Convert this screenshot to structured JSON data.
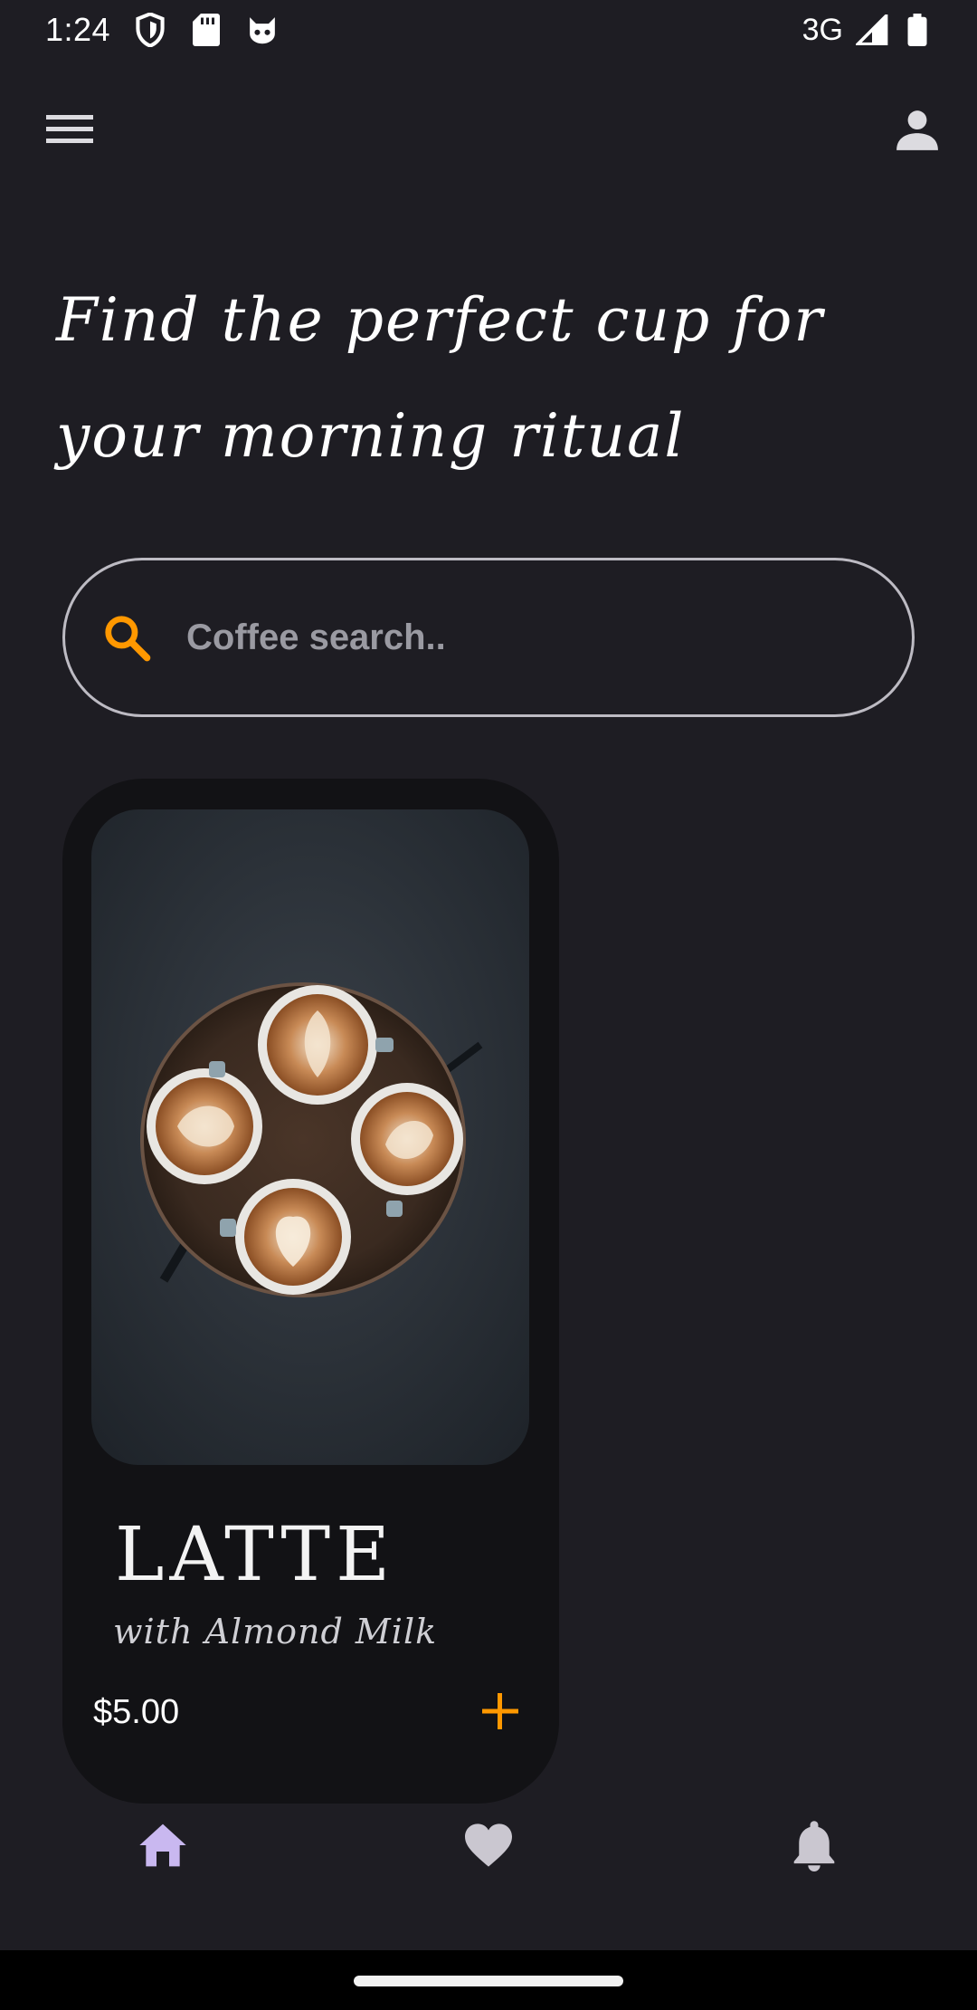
{
  "status_bar": {
    "time": "1:24",
    "network": "3G",
    "icons": [
      "shield-icon",
      "sd-card-icon",
      "cat-face-icon",
      "signal-icon",
      "battery-icon"
    ]
  },
  "app_bar": {
    "icons": [
      "menu-icon",
      "person-icon"
    ]
  },
  "headline": {
    "line1": "Find the perfect cup for",
    "line2": "your morning ritual"
  },
  "search": {
    "placeholder": "Coffee search..",
    "value": "",
    "icon": "search-icon"
  },
  "products": [
    {
      "title": "LATTE",
      "subtitle": "with Almond Milk",
      "price": "$5.00",
      "image": "four latte art cups on wooden table"
    }
  ],
  "bottom_nav": {
    "items": [
      {
        "icon": "home-icon",
        "active": true
      },
      {
        "icon": "heart-icon",
        "active": false
      },
      {
        "icon": "bell-icon",
        "active": false
      }
    ]
  },
  "colors": {
    "background": "#1e1d23",
    "card": "#121215",
    "accent": "#ff9800",
    "nav_active": "#c9b8f0",
    "nav_inactive": "#cac7d0",
    "outline": "#bdbbc3"
  }
}
